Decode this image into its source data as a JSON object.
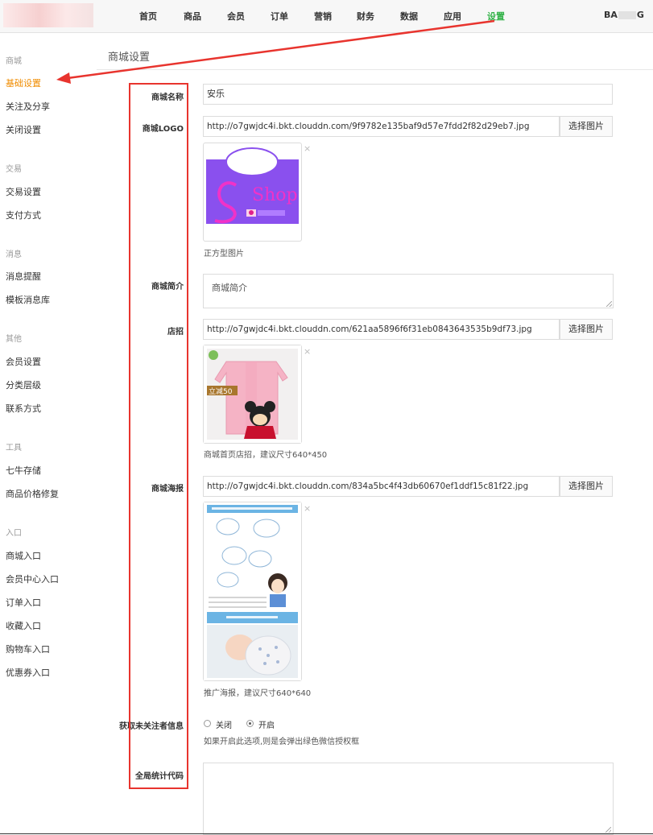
{
  "nav": {
    "items": [
      "首页",
      "商品",
      "会员",
      "订单",
      "营销",
      "财务",
      "数据",
      "应用",
      "设置"
    ],
    "active": "设置",
    "user_prefix": "BA",
    "user_suffix": "G"
  },
  "sidebar": {
    "groups": [
      {
        "title": "商城",
        "items": [
          "基础设置",
          "关注及分享",
          "关闭设置"
        ]
      },
      {
        "title": "交易",
        "items": [
          "交易设置",
          "支付方式"
        ]
      },
      {
        "title": "消息",
        "items": [
          "消息提醒",
          "模板消息库"
        ]
      },
      {
        "title": "其他",
        "items": [
          "会员设置",
          "分类层级",
          "联系方式"
        ]
      },
      {
        "title": "工具",
        "items": [
          "七牛存储",
          "商品价格修复"
        ]
      },
      {
        "title": "入口",
        "items": [
          "商城入口",
          "会员中心入口",
          "订单入口",
          "收藏入口",
          "购物车入口",
          "优惠券入口"
        ]
      }
    ],
    "active_item": "基础设置"
  },
  "page": {
    "title": "商城设置"
  },
  "form": {
    "shop_name": {
      "label": "商城名称",
      "value": "安乐"
    },
    "shop_logo": {
      "label": "商城LOGO",
      "value": "http://o7gwjdc4i.bkt.clouddn.com/9f9782e135baf9d57e7fdd2f82d29eb7.jpg",
      "button": "选择图片",
      "hint": "正方型图片",
      "logo_text": "Shop"
    },
    "shop_intro": {
      "label": "商城简介",
      "placeholder": "商城简介"
    },
    "shop_sign": {
      "label": "店招",
      "value": "http://o7gwjdc4i.bkt.clouddn.com/621aa5896f6f31eb0843643535b9df73.jpg",
      "button": "选择图片",
      "hint": "商城首页店招，建议尺寸640*450",
      "badge_text": "立减50"
    },
    "shop_poster": {
      "label": "商城海报",
      "value": "http://o7gwjdc4i.bkt.clouddn.com/834a5bc4f43db60670ef1ddf15c81f22.jpg",
      "button": "选择图片",
      "hint": "推广海报，建议尺寸640*640"
    },
    "unfollow_info": {
      "label": "获取未关注者信息",
      "options": [
        "关闭",
        "开启"
      ],
      "selected": "开启",
      "hint": "如果开启此选项,则是会弹出绿色微信授权框"
    },
    "stats_code": {
      "label": "全局统计代码",
      "value": ""
    },
    "delete_symbol": "×"
  },
  "colors": {
    "active_nav": "#35b34a",
    "active_sidebar": "#f08c00",
    "annotation_red": "#e8342e"
  }
}
